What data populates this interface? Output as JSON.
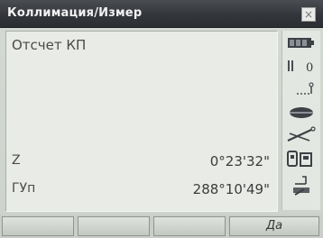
{
  "window": {
    "title": "Коллимация/Измер",
    "close_glyph": "×"
  },
  "screen": {
    "heading": "Отсчет КП",
    "rows": [
      {
        "label": "Z",
        "value": "0°23'32\""
      },
      {
        "label": "ГУп",
        "value": "288°10'49\""
      }
    ]
  },
  "status_panel": {
    "icons": [
      "battery-icon",
      "prism-icon",
      "prism-constant-icon",
      "laser-icon",
      "tilt-icon",
      "memory-icon",
      "input-mode-icon"
    ],
    "prism_constant_text": "0"
  },
  "softkeys": {
    "f1": "",
    "f2": "",
    "f3": "",
    "f4": "Да"
  }
}
